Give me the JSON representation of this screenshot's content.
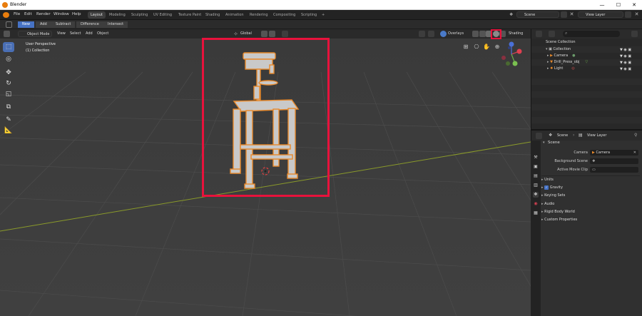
{
  "window": {
    "title": "Blender",
    "minimize": "—",
    "maximize": "☐",
    "close": "✕"
  },
  "menu": [
    "File",
    "Edit",
    "Render",
    "Window",
    "Help"
  ],
  "workspaces": [
    "Layout",
    "Modeling",
    "Sculpting",
    "UV Editing",
    "Texture Paint",
    "Shading",
    "Animation",
    "Rendering",
    "Compositing",
    "Scripting",
    "+"
  ],
  "active_workspace": "Layout",
  "scene_field": "Scene",
  "viewlayer_field": "View Layer",
  "mode_buttons": [
    "New",
    "Add",
    "Subtract",
    "Difference",
    "Intersect"
  ],
  "viewport_header": {
    "mode": "Object Mode",
    "menus": [
      "View",
      "Select",
      "Add",
      "Object"
    ],
    "orientation": "Global",
    "overlays": "Overlays",
    "shading": "Shading"
  },
  "viewport_info": {
    "perspective": "User Perspective",
    "collection": "(1) Collection"
  },
  "outliner": {
    "search_placeholder": "",
    "rows": [
      {
        "label": "Scene Collection",
        "indent": 0
      },
      {
        "label": "Collection",
        "indent": 1
      },
      {
        "label": "Camera",
        "indent": 2
      },
      {
        "label": "Drill_Press_obj",
        "indent": 2
      },
      {
        "label": "Light",
        "indent": 2
      }
    ]
  },
  "properties": {
    "header_scene": "Scene",
    "header_viewlayer": "View Layer",
    "scene_section": "Scene",
    "camera_label": "Camera",
    "camera_value": "Camera",
    "bg_scene_label": "Background Scene",
    "movie_clip_label": "Active Movie Clip",
    "sections": [
      "Units",
      "Gravity",
      "Keying Sets",
      "Audio",
      "Rigid Body World",
      "Custom Properties"
    ]
  },
  "colors": {
    "accent": "#4672c4",
    "highlight": "#e8123c",
    "object_outline": "#e8892b",
    "grid": "#4a4a4a"
  }
}
